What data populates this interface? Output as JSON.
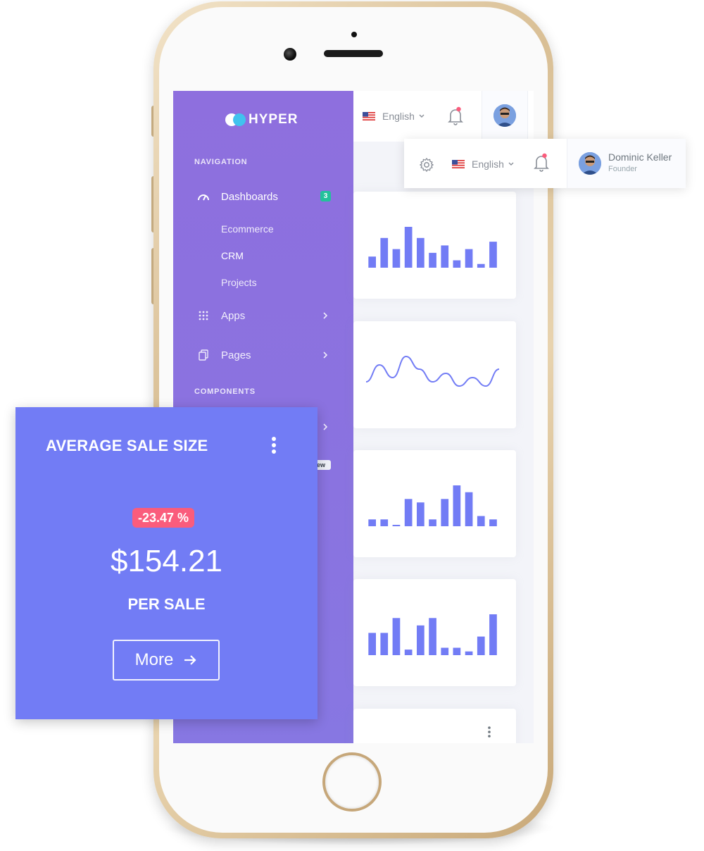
{
  "brand": {
    "name": "HYPER"
  },
  "sidebar": {
    "section_navigation": "NAVIGATION",
    "section_components": "COMPONENTS",
    "dashboards": {
      "label": "Dashboards",
      "badge": "3",
      "icon": "speedometer-icon"
    },
    "sub_items": [
      "Ecommerce",
      "CRM",
      "Projects"
    ],
    "apps": {
      "label": "Apps",
      "icon": "apps-grid-icon"
    },
    "pages": {
      "label": "Pages",
      "icon": "copy-pages-icon"
    },
    "new_badge": "ew"
  },
  "topbar": {
    "language": "English",
    "notification_icon": "bell-icon"
  },
  "float_topbar": {
    "language": "English",
    "user_name": "Dominic Keller",
    "user_role": "Founder"
  },
  "widget": {
    "title": "AVERAGE SALE SIZE",
    "change": "-23.47 %",
    "value": "$154.21",
    "subtitle": "PER SALE",
    "button_label": "More"
  },
  "colors": {
    "sidebar": "#8c72df",
    "widget": "#727cf5",
    "chart": "#727cf5",
    "badge_danger": "#fa5c7c",
    "badge_success": "#23c19b"
  },
  "chart_data": [
    {
      "type": "bar",
      "values": [
        3,
        8,
        5,
        11,
        8,
        4,
        6,
        2,
        5,
        1,
        7
      ]
    },
    {
      "type": "line",
      "values": [
        2,
        6,
        3,
        8,
        5,
        2,
        4,
        1,
        3,
        1,
        5
      ]
    },
    {
      "type": "bar",
      "values": [
        2,
        2,
        0.3,
        8,
        7,
        2,
        8,
        12,
        10,
        3,
        2
      ]
    },
    {
      "type": "bar",
      "values": [
        6,
        6,
        10,
        1.5,
        8,
        10,
        2,
        2,
        1,
        5,
        11
      ]
    }
  ]
}
